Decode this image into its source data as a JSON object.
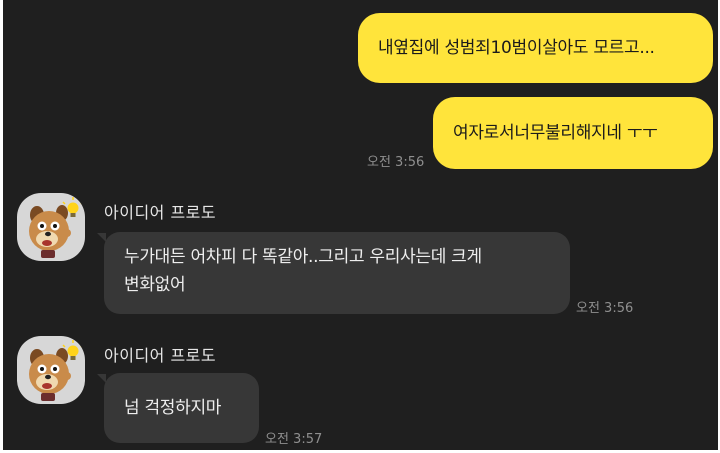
{
  "messages": {
    "sent1": {
      "text": "내옆집에 성범죄10범이살아도 모르고..."
    },
    "sent2": {
      "text": "여자로서너무불리해지네 ㅜㅜ",
      "time": "오전 3:56"
    },
    "recv1": {
      "sender": "아이디어 프로도",
      "line1": "누가대든 어차피 다 똑같아..그리고 우리사는데 크게",
      "line2": "변화없어",
      "time": "오전 3:56"
    },
    "recv2": {
      "sender": "아이디어 프로도",
      "text": "넘 걱정하지마",
      "time": "오전 3:57"
    }
  },
  "colors": {
    "background": "#1f1f1f",
    "my_bubble": "#ffe43b",
    "their_bubble": "#373737"
  },
  "icons": {
    "avatar": "frodo-dog-character-icon"
  }
}
